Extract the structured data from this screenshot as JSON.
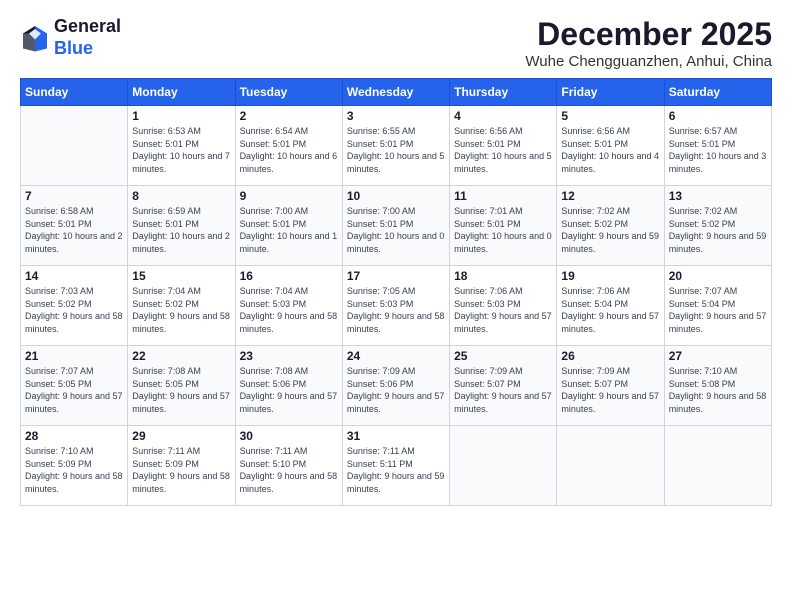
{
  "header": {
    "logo": {
      "general": "General",
      "blue": "Blue"
    },
    "title": "December 2025",
    "location": "Wuhe Chengguanzhen, Anhui, China"
  },
  "weekdays": [
    "Sunday",
    "Monday",
    "Tuesday",
    "Wednesday",
    "Thursday",
    "Friday",
    "Saturday"
  ],
  "weeks": [
    [
      {
        "day": "",
        "sunrise": "",
        "sunset": "",
        "daylight": ""
      },
      {
        "day": "1",
        "sunrise": "Sunrise: 6:53 AM",
        "sunset": "Sunset: 5:01 PM",
        "daylight": "Daylight: 10 hours and 7 minutes."
      },
      {
        "day": "2",
        "sunrise": "Sunrise: 6:54 AM",
        "sunset": "Sunset: 5:01 PM",
        "daylight": "Daylight: 10 hours and 6 minutes."
      },
      {
        "day": "3",
        "sunrise": "Sunrise: 6:55 AM",
        "sunset": "Sunset: 5:01 PM",
        "daylight": "Daylight: 10 hours and 5 minutes."
      },
      {
        "day": "4",
        "sunrise": "Sunrise: 6:56 AM",
        "sunset": "Sunset: 5:01 PM",
        "daylight": "Daylight: 10 hours and 5 minutes."
      },
      {
        "day": "5",
        "sunrise": "Sunrise: 6:56 AM",
        "sunset": "Sunset: 5:01 PM",
        "daylight": "Daylight: 10 hours and 4 minutes."
      },
      {
        "day": "6",
        "sunrise": "Sunrise: 6:57 AM",
        "sunset": "Sunset: 5:01 PM",
        "daylight": "Daylight: 10 hours and 3 minutes."
      }
    ],
    [
      {
        "day": "7",
        "sunrise": "Sunrise: 6:58 AM",
        "sunset": "Sunset: 5:01 PM",
        "daylight": "Daylight: 10 hours and 2 minutes."
      },
      {
        "day": "8",
        "sunrise": "Sunrise: 6:59 AM",
        "sunset": "Sunset: 5:01 PM",
        "daylight": "Daylight: 10 hours and 2 minutes."
      },
      {
        "day": "9",
        "sunrise": "Sunrise: 7:00 AM",
        "sunset": "Sunset: 5:01 PM",
        "daylight": "Daylight: 10 hours and 1 minute."
      },
      {
        "day": "10",
        "sunrise": "Sunrise: 7:00 AM",
        "sunset": "Sunset: 5:01 PM",
        "daylight": "Daylight: 10 hours and 0 minutes."
      },
      {
        "day": "11",
        "sunrise": "Sunrise: 7:01 AM",
        "sunset": "Sunset: 5:01 PM",
        "daylight": "Daylight: 10 hours and 0 minutes."
      },
      {
        "day": "12",
        "sunrise": "Sunrise: 7:02 AM",
        "sunset": "Sunset: 5:02 PM",
        "daylight": "Daylight: 9 hours and 59 minutes."
      },
      {
        "day": "13",
        "sunrise": "Sunrise: 7:02 AM",
        "sunset": "Sunset: 5:02 PM",
        "daylight": "Daylight: 9 hours and 59 minutes."
      }
    ],
    [
      {
        "day": "14",
        "sunrise": "Sunrise: 7:03 AM",
        "sunset": "Sunset: 5:02 PM",
        "daylight": "Daylight: 9 hours and 58 minutes."
      },
      {
        "day": "15",
        "sunrise": "Sunrise: 7:04 AM",
        "sunset": "Sunset: 5:02 PM",
        "daylight": "Daylight: 9 hours and 58 minutes."
      },
      {
        "day": "16",
        "sunrise": "Sunrise: 7:04 AM",
        "sunset": "Sunset: 5:03 PM",
        "daylight": "Daylight: 9 hours and 58 minutes."
      },
      {
        "day": "17",
        "sunrise": "Sunrise: 7:05 AM",
        "sunset": "Sunset: 5:03 PM",
        "daylight": "Daylight: 9 hours and 58 minutes."
      },
      {
        "day": "18",
        "sunrise": "Sunrise: 7:06 AM",
        "sunset": "Sunset: 5:03 PM",
        "daylight": "Daylight: 9 hours and 57 minutes."
      },
      {
        "day": "19",
        "sunrise": "Sunrise: 7:06 AM",
        "sunset": "Sunset: 5:04 PM",
        "daylight": "Daylight: 9 hours and 57 minutes."
      },
      {
        "day": "20",
        "sunrise": "Sunrise: 7:07 AM",
        "sunset": "Sunset: 5:04 PM",
        "daylight": "Daylight: 9 hours and 57 minutes."
      }
    ],
    [
      {
        "day": "21",
        "sunrise": "Sunrise: 7:07 AM",
        "sunset": "Sunset: 5:05 PM",
        "daylight": "Daylight: 9 hours and 57 minutes."
      },
      {
        "day": "22",
        "sunrise": "Sunrise: 7:08 AM",
        "sunset": "Sunset: 5:05 PM",
        "daylight": "Daylight: 9 hours and 57 minutes."
      },
      {
        "day": "23",
        "sunrise": "Sunrise: 7:08 AM",
        "sunset": "Sunset: 5:06 PM",
        "daylight": "Daylight: 9 hours and 57 minutes."
      },
      {
        "day": "24",
        "sunrise": "Sunrise: 7:09 AM",
        "sunset": "Sunset: 5:06 PM",
        "daylight": "Daylight: 9 hours and 57 minutes."
      },
      {
        "day": "25",
        "sunrise": "Sunrise: 7:09 AM",
        "sunset": "Sunset: 5:07 PM",
        "daylight": "Daylight: 9 hours and 57 minutes."
      },
      {
        "day": "26",
        "sunrise": "Sunrise: 7:09 AM",
        "sunset": "Sunset: 5:07 PM",
        "daylight": "Daylight: 9 hours and 57 minutes."
      },
      {
        "day": "27",
        "sunrise": "Sunrise: 7:10 AM",
        "sunset": "Sunset: 5:08 PM",
        "daylight": "Daylight: 9 hours and 58 minutes."
      }
    ],
    [
      {
        "day": "28",
        "sunrise": "Sunrise: 7:10 AM",
        "sunset": "Sunset: 5:09 PM",
        "daylight": "Daylight: 9 hours and 58 minutes."
      },
      {
        "day": "29",
        "sunrise": "Sunrise: 7:11 AM",
        "sunset": "Sunset: 5:09 PM",
        "daylight": "Daylight: 9 hours and 58 minutes."
      },
      {
        "day": "30",
        "sunrise": "Sunrise: 7:11 AM",
        "sunset": "Sunset: 5:10 PM",
        "daylight": "Daylight: 9 hours and 58 minutes."
      },
      {
        "day": "31",
        "sunrise": "Sunrise: 7:11 AM",
        "sunset": "Sunset: 5:11 PM",
        "daylight": "Daylight: 9 hours and 59 minutes."
      },
      {
        "day": "",
        "sunrise": "",
        "sunset": "",
        "daylight": ""
      },
      {
        "day": "",
        "sunrise": "",
        "sunset": "",
        "daylight": ""
      },
      {
        "day": "",
        "sunrise": "",
        "sunset": "",
        "daylight": ""
      }
    ]
  ]
}
